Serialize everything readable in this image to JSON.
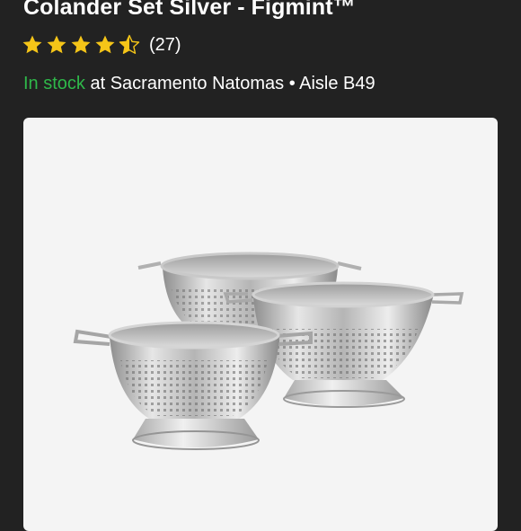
{
  "product": {
    "title": "Colander Set Silver - Figmint™",
    "rating": 4.5,
    "rating_max": 5,
    "review_count": "(27)",
    "stock_status": "In stock",
    "stock_detail": "at Sacramento Natomas • Aisle B49",
    "image_icon": "colander-set-product-image"
  },
  "colors": {
    "background": "#222222",
    "star": "#f5c518",
    "in_stock": "#2fb84a",
    "card": "#f4f4f4"
  }
}
